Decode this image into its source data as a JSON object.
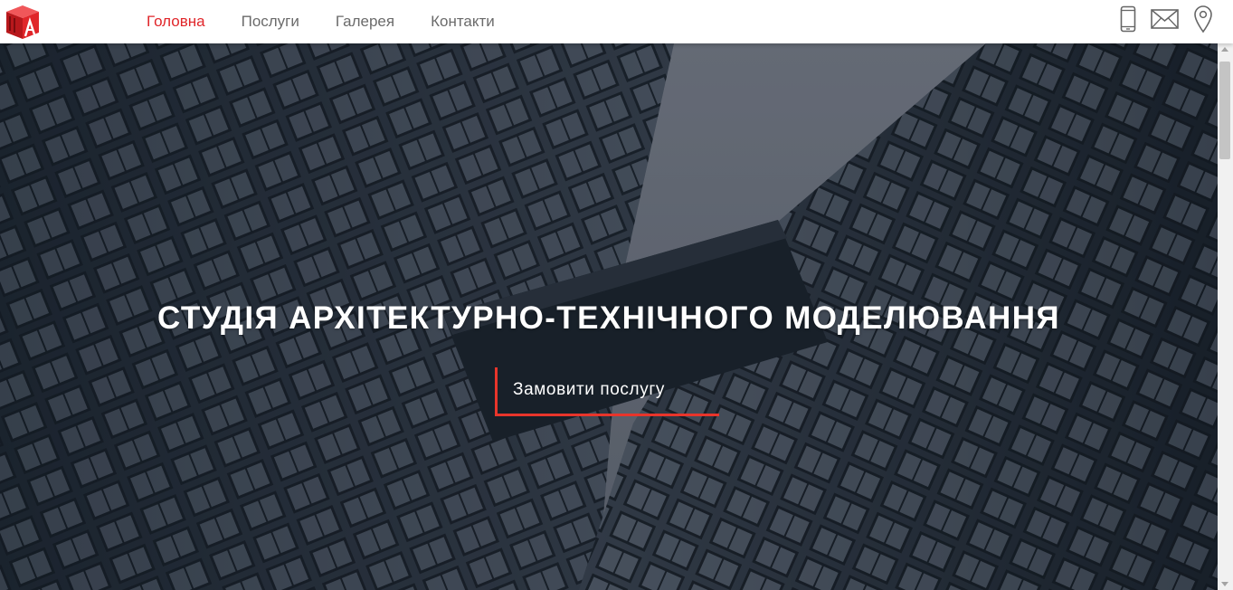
{
  "header": {
    "logo": {
      "icon": "studio-logo",
      "color": "#e0262a"
    },
    "nav": [
      {
        "label": "Головна",
        "active": true
      },
      {
        "label": "Послуги",
        "active": false
      },
      {
        "label": "Галерея",
        "active": false
      },
      {
        "label": "Контакти",
        "active": false
      }
    ],
    "icons": [
      "phone-icon",
      "mail-icon",
      "location-pin-icon"
    ]
  },
  "hero": {
    "title": "СТУДІЯ АРХІТЕКТУРНО-ТЕХНІЧНОГО МОДЕЛЮВАННЯ",
    "cta_label": "Замовити послугу",
    "background": "skyscrapers-photo"
  },
  "colors": {
    "accent": "#e0262a",
    "nav_text": "#6b6b6b",
    "cta_border": "#e8352b",
    "sky": "#7b818d"
  }
}
